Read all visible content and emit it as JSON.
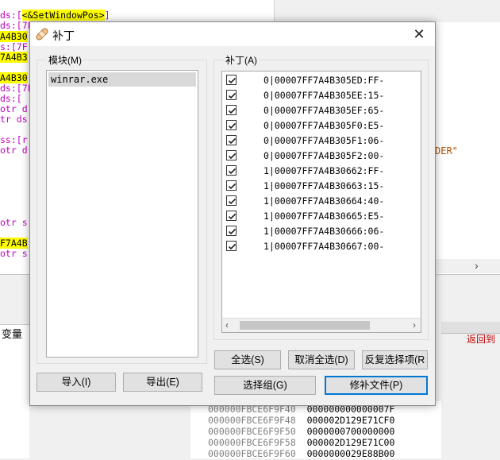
{
  "background": {
    "code_lines": [
      {
        "pre": "ds:[",
        "hl": "<&SetWindowPos>",
        "post": "]"
      },
      {
        "pre": "ds:[7F",
        "hl": "",
        "post": ""
      },
      {
        "pre": "",
        "hl": "A4B30",
        "post": ""
      },
      {
        "pre": "s:[7F",
        "hl": "",
        "post": ""
      },
      {
        "pre": "",
        "hl": "7A4B3",
        "post": ""
      },
      {
        "pre": "",
        "hl": "A4B30",
        "post": ""
      },
      {
        "pre": "ds:[7F",
        "hl": "",
        "post": ""
      },
      {
        "pre": "ds:[",
        "hl": "",
        "post": ""
      },
      {
        "pre": "otr d",
        "hl": "",
        "post": ""
      },
      {
        "pre": "tr ds",
        "hl": "",
        "post": ""
      },
      {
        "pre": "ss:[r",
        "hl": "",
        "post": ""
      },
      {
        "pre": "otr d",
        "hl": "",
        "post": ""
      },
      {
        "pre": "otr s",
        "hl": "",
        "post": ""
      },
      {
        "pre": "",
        "hl": "F7A4B",
        "post": ""
      },
      {
        "pre": "otr s",
        "hl": "",
        "post": ""
      }
    ],
    "string_fragment": "DER\"",
    "variables_tab": "变量",
    "back_link": "返回到",
    "stack_rows": [
      {
        "addr": "000000FBCE6F9F40",
        "val": "000000000000007F"
      },
      {
        "addr": "000000FBCE6F9F48",
        "val": "000002D129E71CF0"
      },
      {
        "addr": "000000FBCE6F9F50",
        "val": "0000000700000000"
      },
      {
        "addr": "000000FBCE6F9F58",
        "val": "000002D129E71C00"
      },
      {
        "addr": "000000FBCE6F9F60",
        "val": "0000000029E88B00"
      }
    ]
  },
  "dialog": {
    "title": "补丁",
    "modules_label": "模块(M)",
    "modules": [
      "winrar.exe"
    ],
    "patches_label": "补丁(A)",
    "patches": [
      "0|00007FF7A4B305ED:FF-",
      "0|00007FF7A4B305EE:15-",
      "0|00007FF7A4B305EF:65-",
      "0|00007FF7A4B305F0:E5-",
      "0|00007FF7A4B305F1:06-",
      "0|00007FF7A4B305F2:00-",
      "1|00007FF7A4B30662:FF-",
      "1|00007FF7A4B30663:15-",
      "1|00007FF7A4B30664:40-",
      "1|00007FF7A4B30665:E5-",
      "1|00007FF7A4B30666:06-",
      "1|00007FF7A4B30667:00-"
    ],
    "buttons": {
      "import": "导入(I)",
      "export": "导出(E)",
      "select_all": "全选(S)",
      "deselect_all": "取消全选(D)",
      "invert": "反复选择项(R",
      "select_group": "选择组(G)",
      "patch_file": "修补文件(P)"
    }
  }
}
